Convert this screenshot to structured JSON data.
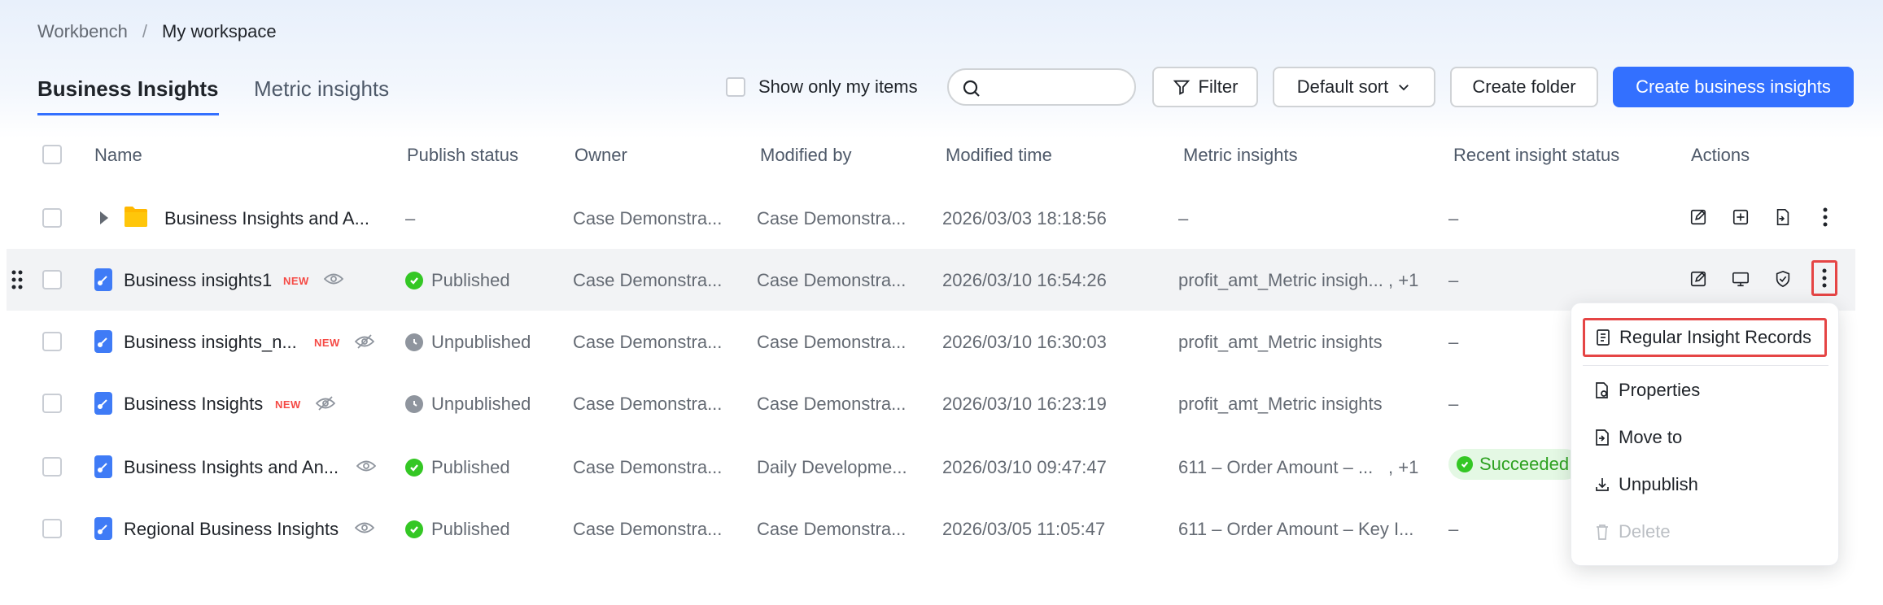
{
  "breadcrumb": {
    "root": "Workbench",
    "separator": "/",
    "current": "My workspace"
  },
  "tabs": [
    {
      "label": "Business Insights",
      "active": true
    },
    {
      "label": "Metric insights",
      "active": false
    }
  ],
  "toolbar": {
    "show_mine_label": "Show only my items",
    "search_placeholder": "",
    "filter_label": "Filter",
    "sort_label": "Default sort",
    "create_folder_label": "Create folder",
    "create_insights_label": "Create business insights"
  },
  "columns": [
    "Name",
    "Publish status",
    "Owner",
    "Modified by",
    "Modified time",
    "Metric insights",
    "Recent insight status",
    "Actions"
  ],
  "rows": [
    {
      "type": "folder",
      "name": "Business Insights and A...",
      "new": false,
      "publish": "–",
      "owner": "Case Demonstra...",
      "modified_by": "Case Demonstra...",
      "modified_time": "2026/03/03 18:18:56",
      "metric": "–",
      "metric_extra": "",
      "recent": "–"
    },
    {
      "type": "file",
      "name": "Business insights1",
      "new": true,
      "publish": "Published",
      "owner": "Case Demonstra...",
      "modified_by": "Case Demonstra...",
      "modified_time": "2026/03/10 16:54:26",
      "metric": "profit_amt_Metric insigh...",
      "metric_extra": ", +1",
      "recent": "–"
    },
    {
      "type": "file",
      "name": "Business insights_n...",
      "new": true,
      "publish": "Unpublished",
      "owner": "Case Demonstra...",
      "modified_by": "Case Demonstra...",
      "modified_time": "2026/03/10 16:30:03",
      "metric": "profit_amt_Metric insights",
      "metric_extra": "",
      "recent": "–"
    },
    {
      "type": "file",
      "name": "Business Insights",
      "new": true,
      "publish": "Unpublished",
      "owner": "Case Demonstra...",
      "modified_by": "Case Demonstra...",
      "modified_time": "2026/03/10 16:23:19",
      "metric": "profit_amt_Metric insights",
      "metric_extra": "",
      "recent": "–"
    },
    {
      "type": "file",
      "name": "Business Insights and An...",
      "new": false,
      "publish": "Published",
      "owner": "Case Demonstra...",
      "modified_by": "Daily Developme...",
      "modified_time": "2026/03/10 09:47:47",
      "metric": "611 – Order Amount – ...",
      "metric_extra": ", +1",
      "recent": "Succeeded"
    },
    {
      "type": "file",
      "name": "Regional Business Insights",
      "new": false,
      "publish": "Published",
      "owner": "Case Demonstra...",
      "modified_by": "Case Demonstra...",
      "modified_time": "2026/03/05 11:05:47",
      "metric": "611 – Order Amount – Key I...",
      "metric_extra": "",
      "recent": "–"
    }
  ],
  "new_badge": "NEW",
  "menu": {
    "items": [
      {
        "label": "Regular Insight Records",
        "icon": "document-list-icon"
      },
      {
        "label": "Properties",
        "icon": "file-settings-icon"
      },
      {
        "label": "Move to",
        "icon": "move-file-icon"
      },
      {
        "label": "Unpublish",
        "icon": "unpublish-icon"
      },
      {
        "label": "Delete",
        "icon": "trash-icon",
        "disabled": true
      }
    ]
  },
  "colors": {
    "primary": "#3370ff",
    "published": "#34c724",
    "unpublished": "#8f959e",
    "new_badge": "#f54a45",
    "highlight": "#e54545"
  }
}
